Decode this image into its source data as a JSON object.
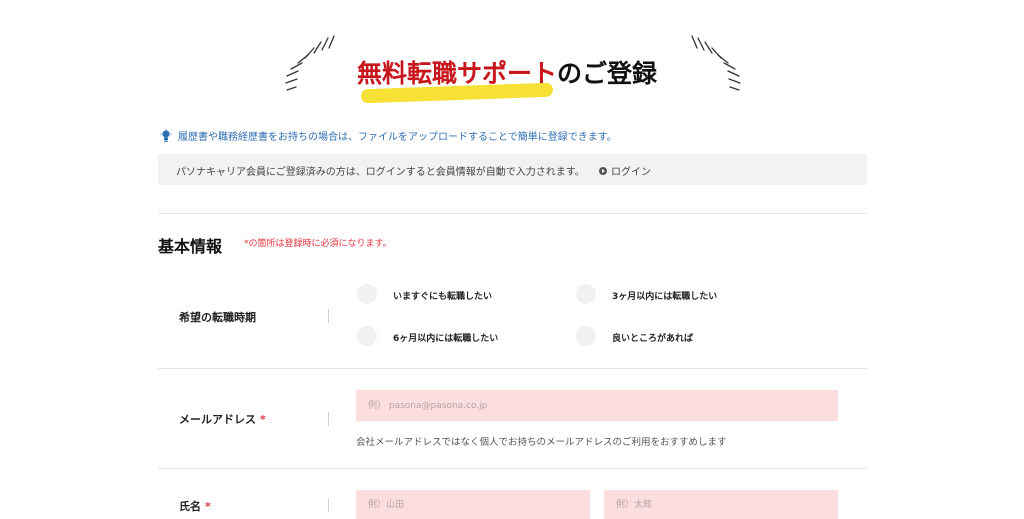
{
  "header": {
    "title_red": "無料転職サポート",
    "title_black": "のご登録"
  },
  "hint": {
    "icon": "lightbulb-icon",
    "text": "履歴書や職務経歴書をお持ちの場合は、ファイルをアップロードすることで簡単に登録できます。"
  },
  "banner": {
    "text": "パソナキャリア会員にご登録済みの方は、ログインすると会員情報が自動で入力されます。",
    "login_label": "ログイン"
  },
  "section": {
    "title": "基本情報",
    "required_note": "*の箇所は登録時に必須になります。"
  },
  "timing": {
    "label": "希望の転職時期",
    "options": [
      "いますぐにも転職したい",
      "3ヶ月以内には転職したい",
      "6ヶ月以内には転職したい",
      "良いところがあれば"
    ]
  },
  "email": {
    "label": "メールアドレス",
    "required": "*",
    "placeholder": "例） pasona@pasona.co.jp",
    "note": "会社メールアドレスではなく個人でお持ちのメールアドレスのご利用をおすすめします"
  },
  "name": {
    "label": "氏名",
    "required": "*",
    "last_placeholder": "例）山田",
    "first_placeholder": "例）太郎"
  },
  "colors": {
    "accent_red": "#c8161d",
    "highlight_yellow": "#f7e135",
    "link_blue": "#2f6fb5",
    "input_bg": "#fddede"
  }
}
